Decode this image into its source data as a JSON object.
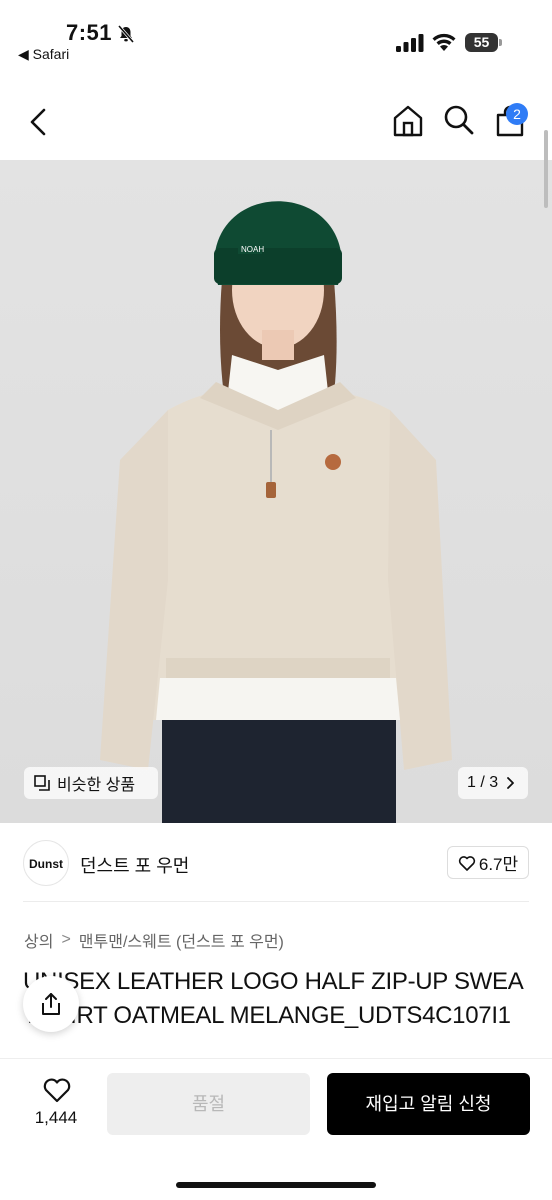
{
  "status_bar": {
    "time": "7:51",
    "back_app": "◀ Safari",
    "battery": "55"
  },
  "nav": {
    "cart_count": "2"
  },
  "image": {
    "similar_label": "비슷한 상품",
    "pager": "1 / 3"
  },
  "brand": {
    "logo_text": "Dunst",
    "name": "던스트 포 우먼",
    "likes": "6.7만"
  },
  "breadcrumb": {
    "category": "상의",
    "separator": ">",
    "subcategory": "맨투맨/스웨트 (던스트 포 우먼)"
  },
  "product": {
    "title": "UNISEX LEATHER LOGO HALF ZIP-UP SWEATSHIRT OATMEAL MELANGE_UDTS4C107I1"
  },
  "bottom": {
    "wish_count": "1,444",
    "soldout_label": "품절",
    "restock_label": "재입고 알림 신청"
  },
  "icons": {
    "back": "chevron-left-icon",
    "home": "home-icon",
    "search": "search-icon",
    "cart": "shopping-bag-icon",
    "share": "share-icon",
    "heart": "heart-icon"
  },
  "colors": {
    "accent_badge": "#2f7cf6",
    "primary_button": "#000000",
    "disabled_button": "#eeeeee",
    "beanie": "#0f4a33",
    "sweatshirt": "#e6ddcf"
  }
}
